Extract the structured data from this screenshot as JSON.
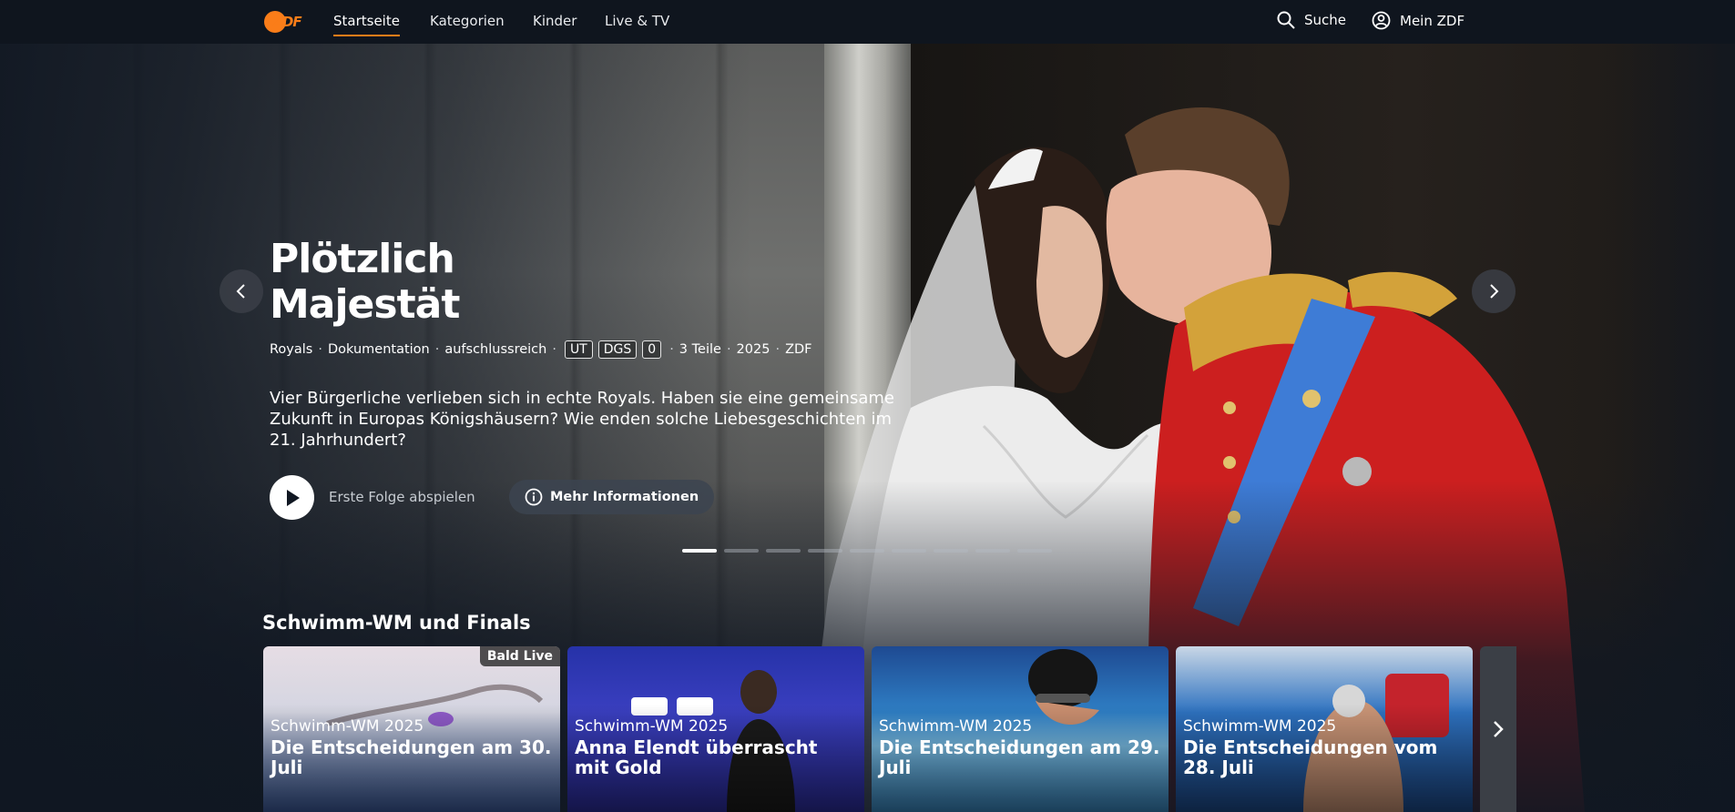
{
  "nav": {
    "logo_text": "ZDF",
    "links": [
      "Startseite",
      "Kategorien",
      "Kinder",
      "Live & TV"
    ],
    "search_label": "Suche",
    "account_label": "Mein ZDF"
  },
  "hero": {
    "title_line1": "Plötzlich",
    "title_line2": "Majestät",
    "meta": {
      "genre1": "Royals",
      "genre2": "Dokumentation",
      "genre3": "aufschlussreich",
      "badge_ut": "UT",
      "badge_dgs": "DGS",
      "badge_age": "0",
      "episodes": "3 Teile",
      "year": "2025",
      "channel": "ZDF"
    },
    "description": "Vier Bürgerliche verlieben sich in echte Royals. Haben sie eine gemein­same Zukunft in Europas Königshäusern? Wie enden solche Liebesge­schichten im 21. Jahrhundert?",
    "play_label": "Erste Folge abspielen",
    "info_label": "Mehr Informationen",
    "carousel_dots": 9,
    "active_dot": 1
  },
  "row": {
    "title": "Schwimm-WM und Finals",
    "cards": [
      {
        "category": "Schwimm-WM 2025",
        "title": "Die Entscheidungen am 30. Juli",
        "badge": "Bald Live"
      },
      {
        "category": "Schwimm-WM 2025",
        "title": "Anna Elendt überrascht mit Gold"
      },
      {
        "category": "Schwimm-WM 2025",
        "title": "Die Entscheidungen am 29. Juli"
      },
      {
        "category": "Schwimm-WM 2025",
        "title": "Die Entscheidungen vom 28. Juli"
      }
    ]
  },
  "colors": {
    "accent": "#fa7d19",
    "background": "#101722",
    "nav_bg": "#0f151e"
  }
}
